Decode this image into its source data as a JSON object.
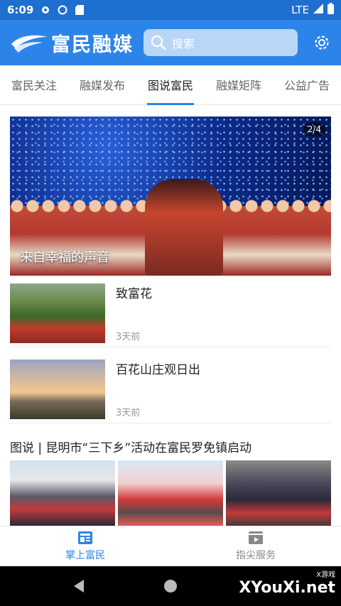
{
  "statusbar": {
    "time": "6:09",
    "network": "LTE"
  },
  "header": {
    "app_name": "富民融媒",
    "search_placeholder": "搜索"
  },
  "tabs": [
    {
      "label": "富民关注"
    },
    {
      "label": "融媒发布"
    },
    {
      "label": "图说富民",
      "active": true
    },
    {
      "label": "融媒矩阵"
    },
    {
      "label": "公益广告"
    }
  ],
  "banner": {
    "caption": "来自幸福的声音",
    "pager": "2/4"
  },
  "articles": [
    {
      "title": "致富花",
      "time": "3天前"
    },
    {
      "title": "百花山庄观日出",
      "time": "3天前"
    }
  ],
  "gallery": {
    "title": "图说 | 昆明市“三下乡”活动在富民罗免镇启动"
  },
  "bottom_nav": [
    {
      "label": "掌上富民",
      "active": true
    },
    {
      "label": "指尖服务"
    }
  ],
  "watermark": {
    "small": "X游戏",
    "big": "XYouXi.net"
  },
  "colors": {
    "brand_blue": "#2c84e8",
    "status_blue": "#1e6fd0"
  }
}
